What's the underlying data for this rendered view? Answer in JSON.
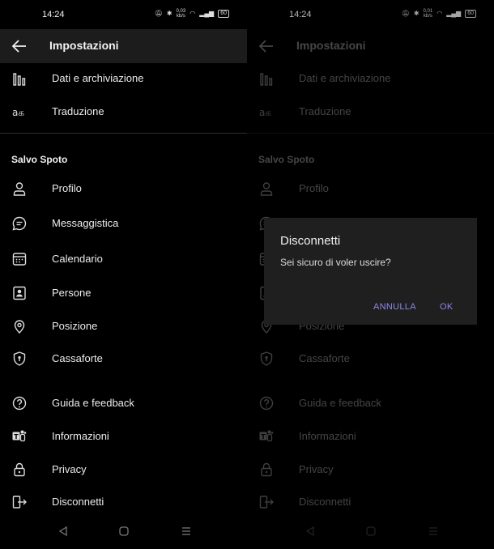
{
  "status": {
    "time": "14:24",
    "net_left": "0,03\nkb/s",
    "net_right": "0,01\nkb/s",
    "battery": "60"
  },
  "header": {
    "title": "Impostazioni"
  },
  "menu_top": [
    {
      "label": "Dati e archiviazione",
      "icon": "bar-chart-icon"
    },
    {
      "label": "Traduzione",
      "icon": "translate-icon"
    }
  ],
  "account": {
    "name": "Salvo Spoto"
  },
  "menu_account": [
    {
      "label": "Profilo",
      "icon": "person-icon"
    },
    {
      "label": "Messaggistica",
      "icon": "chat-bubble-icon"
    },
    {
      "label": "Calendario",
      "icon": "calendar-icon"
    },
    {
      "label": "Persone",
      "icon": "contacts-icon"
    },
    {
      "label": "Posizione",
      "icon": "location-pin-icon"
    },
    {
      "label": "Cassaforte",
      "icon": "shield-icon"
    }
  ],
  "menu_bottom": [
    {
      "label": "Guida e feedback",
      "icon": "help-icon"
    },
    {
      "label": "Informazioni",
      "icon": "teams-logo-icon"
    },
    {
      "label": "Privacy",
      "icon": "lock-icon"
    },
    {
      "label": "Disconnetti",
      "icon": "sign-out-icon"
    }
  ],
  "dialog": {
    "title": "Disconnetti",
    "message": "Sei sicuro di voler uscire?",
    "cancel": "ANNULLA",
    "ok": "OK"
  },
  "colors": {
    "accent": "#8e86e8",
    "background": "#000000",
    "header": "#1c1c1c",
    "dialog": "#1f1f1f"
  }
}
